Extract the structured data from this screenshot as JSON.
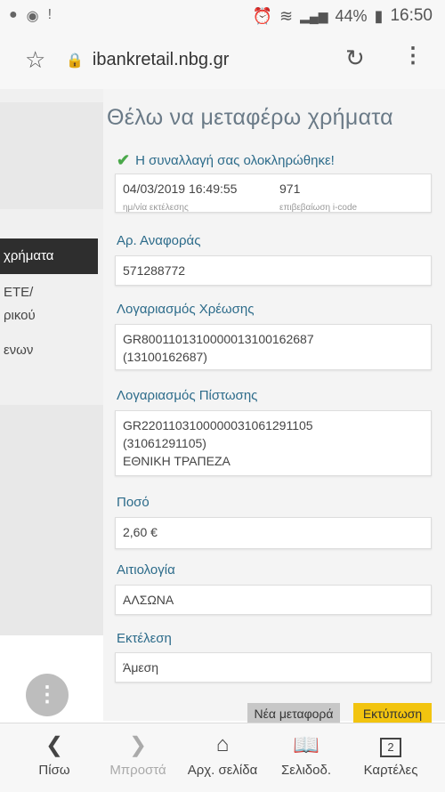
{
  "status_bar": {
    "battery": "44%",
    "time": "16:50"
  },
  "browser": {
    "url": "ibankretail.nbg.gr"
  },
  "sidebar": {
    "active_item": "χρήματα",
    "items": [
      "ΕΤΕ/",
      "ρικού",
      "ενων"
    ]
  },
  "page_title": "Θέλω να μεταφέρω χρήματα",
  "success_message": "Η συναλλαγή σας ολοκληρώθηκε!",
  "execution": {
    "datetime": "04/03/2019 16:49:55",
    "datetime_label": "ημ/νία εκτέλεσης",
    "icode": "971",
    "icode_label": "επιβεβαίωση i-code"
  },
  "reference": {
    "label": "Αρ. Αναφοράς",
    "value": "571288772"
  },
  "debit": {
    "label": "Λογαριασμός Χρέωσης",
    "iban": "GR8001101310000013100162687",
    "account": "(13100162687)"
  },
  "credit": {
    "label": "Λογαριασμός Πίστωσης",
    "iban": "GR2201103100000031061291105",
    "account": "(31061291105)",
    "bank": "ΕΘΝΙΚΗ ΤΡΑΠΕΖΑ"
  },
  "amount": {
    "label": "Ποσό",
    "value": "2,60 €"
  },
  "reason": {
    "label": "Αιτιολογία",
    "value": "ΑΛΣΩΝΑ"
  },
  "execution_type": {
    "label": "Εκτέλεση",
    "value": "Άμεση"
  },
  "buttons": {
    "new_transfer": "Νέα μεταφορά",
    "print": "Εκτύπωση"
  },
  "bottom_nav": {
    "back": "Πίσω",
    "forward": "Μπροστά",
    "home": "Αρχ. σελίδα",
    "bookmarks": "Σελιδοδ.",
    "tabs": "Καρτέλες",
    "tabs_count": "2"
  }
}
